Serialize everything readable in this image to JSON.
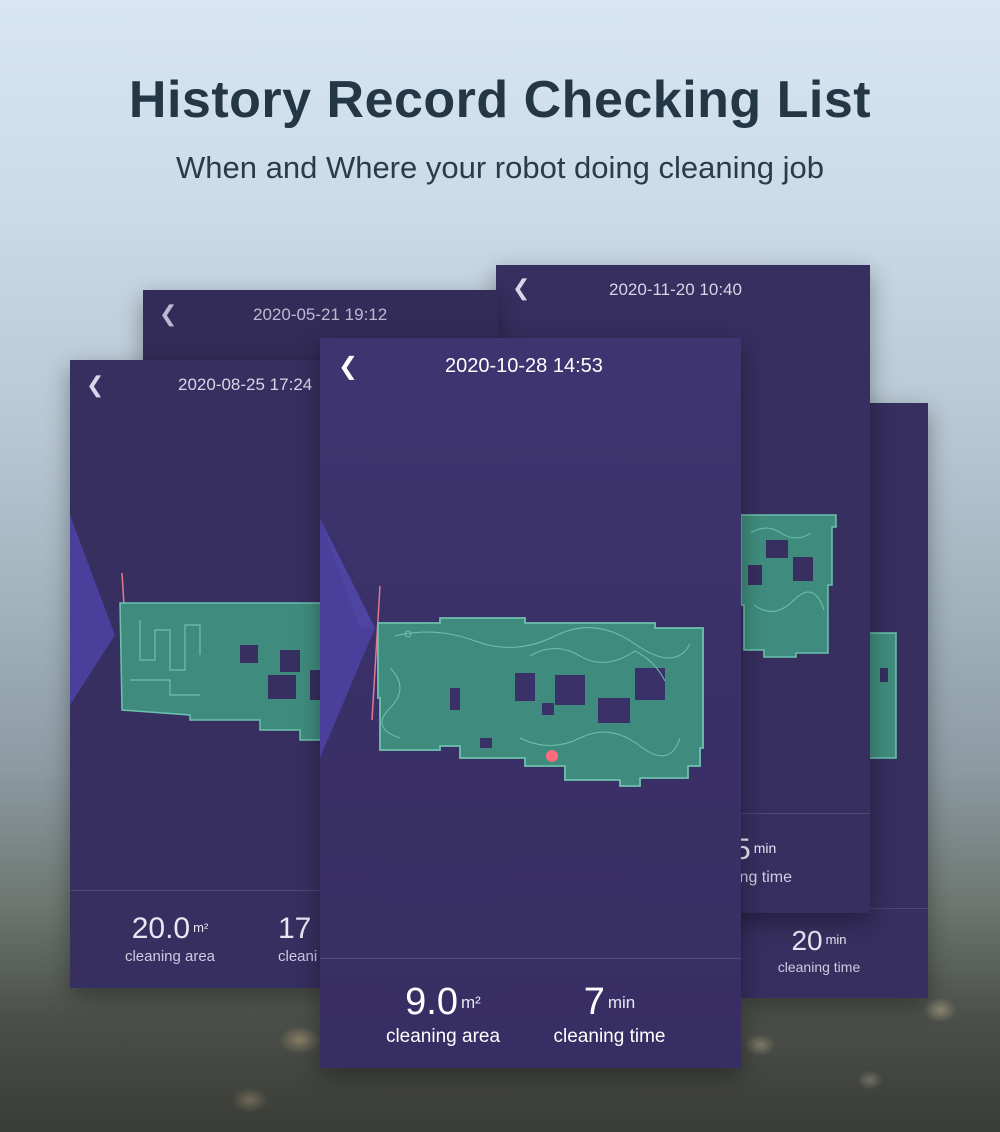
{
  "header": {
    "title": "History Record Checking List",
    "subtitle": "When and Where your robot doing cleaning job"
  },
  "colors": {
    "card_bg": "#362f5f",
    "map_fill": "#3f8c7e",
    "map_outline": "#6dc2ae",
    "robot_dot": "#ff6b7a",
    "charger_line": "#e07a8a",
    "scan_cone": "#4a3f9a"
  },
  "cards": {
    "back_left": {
      "date": "2020-08-25 17:24",
      "area_value": "20.0",
      "area_unit": "m²",
      "area_label": "cleaning area",
      "time_value_partial": "17",
      "time_label_partial": "cleani"
    },
    "back_top_left": {
      "date": "2020-05-21 19:12"
    },
    "back_top_right": {
      "date": "2020-11-20 10:40",
      "time_value_partial": "5",
      "time_unit": "min",
      "time_label_partial": "ing time"
    },
    "back_far_right": {
      "time_value": "20",
      "time_unit": "min",
      "time_label": "cleaning time"
    },
    "main": {
      "date": "2020-10-28 14:53",
      "area_value": "9.0",
      "area_unit": "m²",
      "area_label": "cleaning area",
      "time_value": "7",
      "time_unit": "min",
      "time_label": "cleaning time"
    }
  },
  "icons": {
    "back": "chevron-left-icon"
  }
}
